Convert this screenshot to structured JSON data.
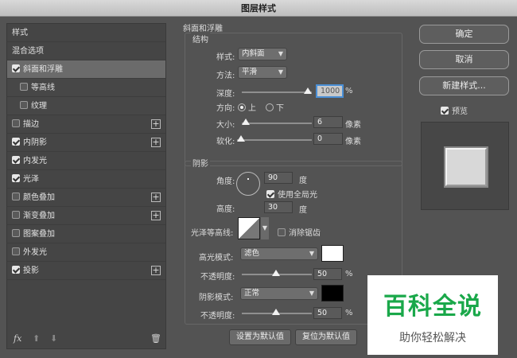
{
  "window": {
    "title": "图层样式"
  },
  "sidebar": {
    "items": [
      {
        "label": "样式",
        "checkbox": false,
        "checked": false,
        "plus": false
      },
      {
        "label": "混合选项",
        "checkbox": false,
        "checked": false,
        "plus": false
      },
      {
        "label": "斜面和浮雕",
        "checkbox": true,
        "checked": true,
        "plus": false,
        "selected": true
      },
      {
        "label": "等高线",
        "checkbox": true,
        "checked": false,
        "plus": false,
        "sub": true
      },
      {
        "label": "纹理",
        "checkbox": true,
        "checked": false,
        "plus": false,
        "sub": true
      },
      {
        "label": "描边",
        "checkbox": true,
        "checked": false,
        "plus": true
      },
      {
        "label": "内阴影",
        "checkbox": true,
        "checked": true,
        "plus": true
      },
      {
        "label": "内发光",
        "checkbox": true,
        "checked": true,
        "plus": false
      },
      {
        "label": "光泽",
        "checkbox": true,
        "checked": true,
        "plus": false
      },
      {
        "label": "颜色叠加",
        "checkbox": true,
        "checked": false,
        "plus": true
      },
      {
        "label": "渐变叠加",
        "checkbox": true,
        "checked": false,
        "plus": true
      },
      {
        "label": "图案叠加",
        "checkbox": true,
        "checked": false,
        "plus": false
      },
      {
        "label": "外发光",
        "checkbox": true,
        "checked": false,
        "plus": false
      },
      {
        "label": "投影",
        "checkbox": true,
        "checked": true,
        "plus": true
      }
    ],
    "footer": {
      "fx": "fx",
      "up": "⬆",
      "down": "⬇",
      "trash": "🗑"
    }
  },
  "bevel": {
    "section_title": "斜面和浮雕",
    "structure_title": "结构",
    "style_label": "样式:",
    "style_value": "内斜面",
    "technique_label": "方法:",
    "technique_value": "平滑",
    "depth_label": "深度:",
    "depth_value": "1000",
    "depth_unit": "%",
    "depth_fraction": 1.0,
    "direction_label": "方向:",
    "dir_up": "上",
    "dir_down": "下",
    "size_label": "大小:",
    "size_value": "6",
    "size_unit": "像素",
    "size_fraction": 0.0,
    "soften_label": "软化:",
    "soften_value": "0",
    "soften_unit": "像素",
    "soften_fraction": 0.0
  },
  "shading": {
    "title": "阴影",
    "angle_label": "角度:",
    "angle_value": "90",
    "angle_unit": "度",
    "global_light_label": "使用全局光",
    "global_light": true,
    "altitude_label": "高度:",
    "altitude_value": "30",
    "altitude_unit": "度",
    "gloss_label": "光泽等高线:",
    "antialias_label": "消除锯齿",
    "antialias": false,
    "highlight_mode_label": "高光模式:",
    "highlight_mode": "滤色",
    "highlight_color": "#ffffff",
    "highlight_opacity_label": "不透明度:",
    "highlight_opacity": "50",
    "highlight_opacity_unit": "%",
    "highlight_opacity_fraction": 0.5,
    "shadow_mode_label": "阴影模式:",
    "shadow_mode": "正常",
    "shadow_color": "#000000",
    "shadow_opacity_label": "不透明度:",
    "shadow_opacity": "50",
    "shadow_opacity_unit": "%",
    "shadow_opacity_fraction": 0.5
  },
  "buttons": {
    "set_default": "设置为默认值",
    "reset_default": "复位为默认值"
  },
  "right": {
    "ok": "确定",
    "cancel": "取消",
    "new_style": "新建样式...",
    "preview_label": "预览",
    "preview": true
  },
  "watermark": {
    "title": "百科全说",
    "subtitle": "助你轻松解决"
  },
  "colors": {
    "panel": "#535353",
    "sidebar": "#454545",
    "selected": "#6b6b6b",
    "watermark_green": "#1aa84a"
  }
}
